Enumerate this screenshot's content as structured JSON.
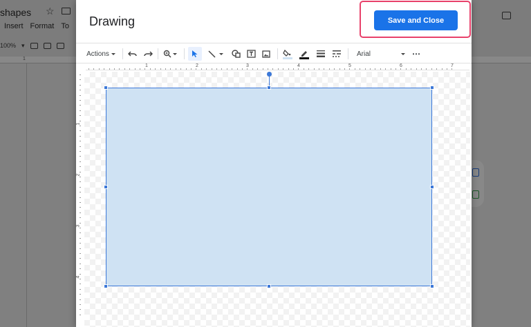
{
  "background_doc": {
    "title": "shapes",
    "menu": [
      "Insert",
      "Format",
      "To"
    ],
    "zoom": "100%",
    "ruler_numbers": [
      "1"
    ]
  },
  "dialog": {
    "title": "Drawing",
    "save_close_label": "Save and Close",
    "toolbar": {
      "actions_label": "Actions",
      "font": "Arial",
      "more": "⋯"
    },
    "ruler_h_numbers": [
      "1",
      "2",
      "3",
      "4",
      "5",
      "6",
      "7"
    ],
    "ruler_v_numbers": [
      "1",
      "2",
      "3",
      "4"
    ],
    "shape_fill": "#cfe2f3",
    "shape_border": "#3c78d8",
    "accent": "#1a73e8",
    "highlight": "#e8406a"
  }
}
